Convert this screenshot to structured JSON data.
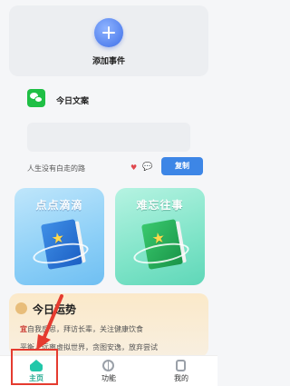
{
  "add_event": {
    "label": "添加事件"
  },
  "daily_copy": {
    "title": "今日文案",
    "quote": "人生没有白走的路",
    "copy_button": "复制"
  },
  "features": [
    {
      "title": "点点滴滴",
      "color": "#8ccff7"
    },
    {
      "title": "难忘往事",
      "color": "#7fe4c8"
    }
  ],
  "fortune": {
    "title": "今日运势",
    "yi_label": "宜",
    "line1_rest": "自我反思，拜访长辈，关注健康饮食",
    "line2": "平衡，远离虚拟世界，贪图安逸，放弃尝试"
  },
  "tabbar": {
    "items": [
      {
        "label": "主页",
        "icon": "home-icon",
        "active": true
      },
      {
        "label": "功能",
        "icon": "function-icon",
        "active": false
      },
      {
        "label": "我的",
        "icon": "profile-icon",
        "active": false
      }
    ]
  },
  "colors": {
    "accent": "#3d86e6",
    "active_tab": "#22a98f",
    "highlight": "#e53b2f"
  }
}
